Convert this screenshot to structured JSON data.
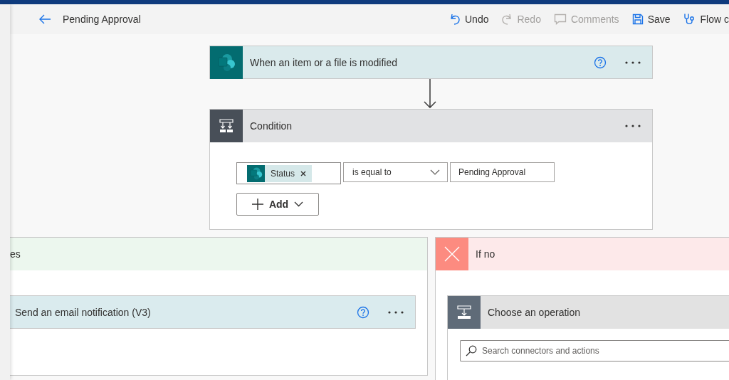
{
  "header": {
    "title": "Pending Approval",
    "actions": [
      {
        "kind": "undo",
        "label": "Undo",
        "disabled": false
      },
      {
        "kind": "redo",
        "label": "Redo",
        "disabled": true
      },
      {
        "kind": "comments",
        "label": "Comments",
        "disabled": true
      },
      {
        "kind": "save",
        "label": "Save",
        "disabled": false
      },
      {
        "kind": "checker",
        "label": "Flow c",
        "disabled": false
      }
    ]
  },
  "trigger": {
    "title": "When an item or a file is modified"
  },
  "condition": {
    "title": "Condition",
    "operand": "Status",
    "operator": "is equal to",
    "value": "Pending Approval",
    "add_button": "Add"
  },
  "yes_branch": {
    "title": "es",
    "actions": [
      {
        "title": "Send an email notification (V3)"
      }
    ]
  },
  "no_branch": {
    "title": "If no",
    "operation": {
      "title": "Choose an operation",
      "search_placeholder": "Search connectors and actions"
    }
  }
}
